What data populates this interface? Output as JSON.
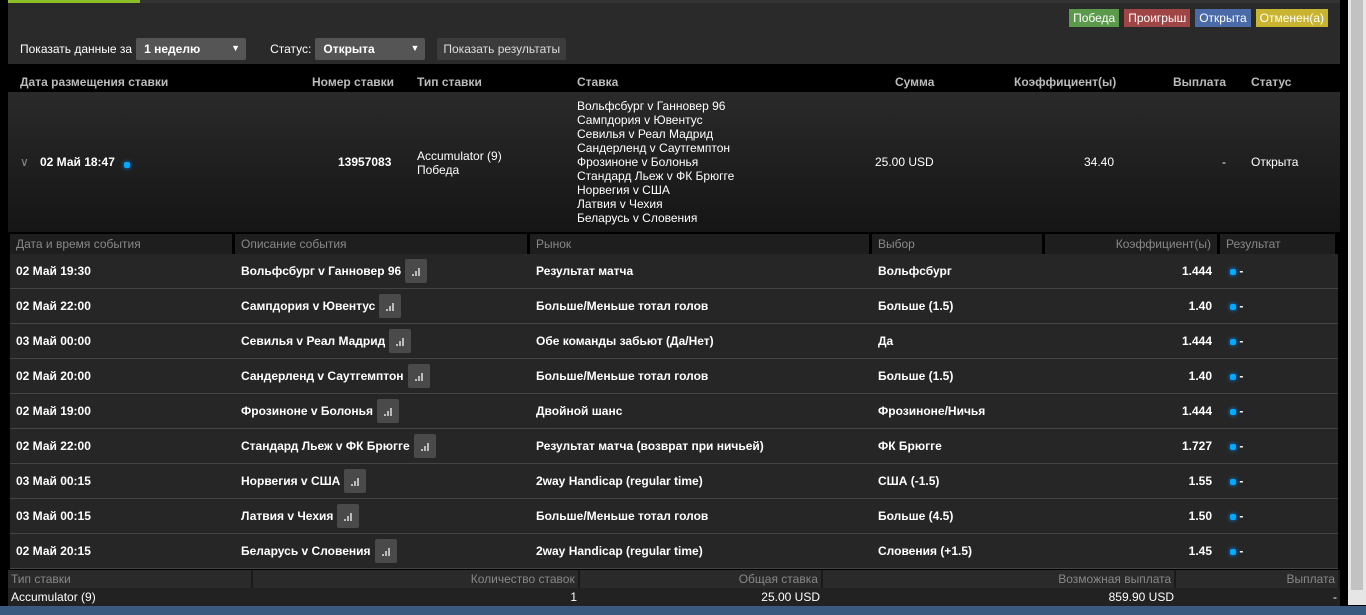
{
  "legend": [
    {
      "label": "Победа",
      "color": "#5a9a4a"
    },
    {
      "label": "Проигрыш",
      "color": "#a04545"
    },
    {
      "label": "Открыта",
      "color": "#4a6aa8"
    },
    {
      "label": "Отменен(а)",
      "color": "#c8b430"
    }
  ],
  "filters": {
    "period_label": "Показать данные за",
    "period_value": "1 неделю",
    "status_label": "Статус:",
    "status_value": "Открыта",
    "show_button": "Показать результаты"
  },
  "columns": [
    "Дата размещения ставки",
    "Номер ставки",
    "Тип ставки",
    "Ставка",
    "Сумма",
    "Коэффициент(ы)",
    "Выплата",
    "Статус"
  ],
  "bet": {
    "date": "02 Май 18:47",
    "number": "13957083",
    "type": "Accumulator (9)",
    "type_result": "Победа",
    "amount": "25.00 USD",
    "odds": "34.40",
    "payout": "-",
    "status": "Открыта",
    "selections": [
      "Вольфсбург v Ганновер 96",
      "Сампдория v Ювентус",
      "Севилья v Реал Мадрид",
      "Сандерленд v Саутгемптон",
      "Фрозиноне v Болонья",
      "Стандард Льеж v ФК Брюгге",
      "Норвегия v США",
      "Латвия v Чехия",
      "Беларусь v Словения"
    ]
  },
  "sub_columns": [
    "Дата и время события",
    "Описание события",
    "Рынок",
    "Выбор",
    "Коэффициент(ы)",
    "Результат"
  ],
  "legs": [
    {
      "date": "02 Май 19:30",
      "event": "Вольфсбург v Ганновер 96",
      "market": "Результат матча",
      "selection": "Вольфсбург",
      "odds": "1.444",
      "result": "-"
    },
    {
      "date": "02 Май 22:00",
      "event": "Сампдория v Ювентус",
      "market": "Больше/Меньше тотал голов",
      "selection": "Больше (1.5)",
      "odds": "1.40",
      "result": "-"
    },
    {
      "date": "03 Май 00:00",
      "event": "Севилья v Реал Мадрид",
      "market": "Обе команды забьют (Да/Нет)",
      "selection": "Да",
      "odds": "1.444",
      "result": "-"
    },
    {
      "date": "02 Май 20:00",
      "event": "Сандерленд v Саутгемптон",
      "market": "Больше/Меньше тотал голов",
      "selection": "Больше (1.5)",
      "odds": "1.40",
      "result": "-"
    },
    {
      "date": "02 Май 19:00",
      "event": "Фрозиноне v Болонья",
      "market": "Двойной шанс",
      "selection": "Фрозиноне/Ничья",
      "odds": "1.444",
      "result": "-"
    },
    {
      "date": "02 Май 22:00",
      "event": "Стандард Льеж v ФК Брюгге",
      "market": "Результат матча (возврат при ничьей)",
      "selection": "ФК Брюгге",
      "odds": "1.727",
      "result": "-"
    },
    {
      "date": "03 Май 00:15",
      "event": "Норвегия v США",
      "market": "2way Handicap (regular time)",
      "selection": "США (-1.5)",
      "odds": "1.55",
      "result": "-"
    },
    {
      "date": "03 Май 00:15",
      "event": "Латвия v Чехия",
      "market": "Больше/Меньше тотал голов",
      "selection": "Больше (4.5)",
      "odds": "1.50",
      "result": "-"
    },
    {
      "date": "02 Май 20:15",
      "event": "Беларусь v Словения",
      "market": "2way Handicap (regular time)",
      "selection": "Словения (+1.5)",
      "odds": "1.45",
      "result": "-"
    }
  ],
  "summary": {
    "headers": [
      "Тип ставки",
      "Количество ставок",
      "Общая ставка",
      "Возможная выплата",
      "Выплата"
    ],
    "values": [
      "Accumulator (9)",
      "1",
      "25.00 USD",
      "859.90 USD",
      "-"
    ]
  }
}
